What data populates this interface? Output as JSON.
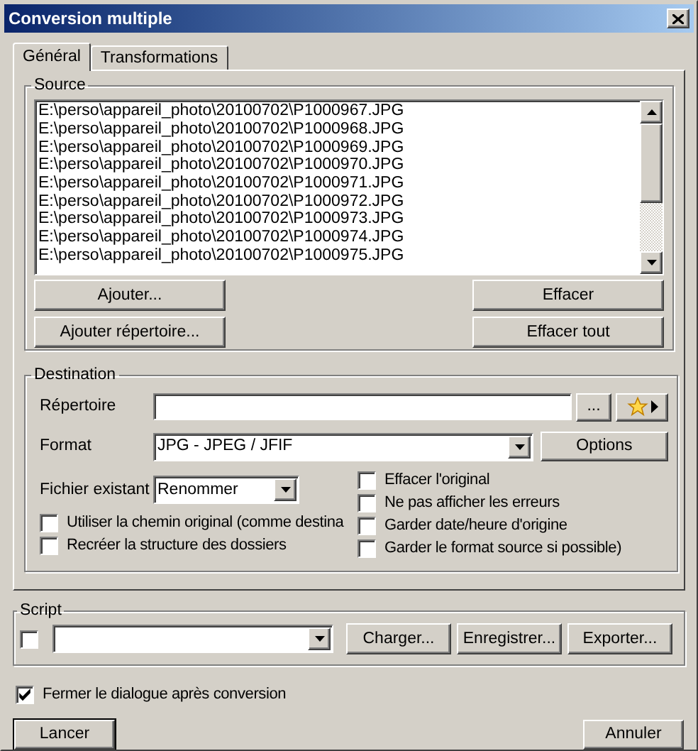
{
  "window": {
    "title": "Conversion multiple"
  },
  "tabs": [
    {
      "label": "Général",
      "selected": true
    },
    {
      "label": "Transformations",
      "selected": false
    }
  ],
  "source": {
    "label": "Source",
    "files": [
      "E:\\perso\\appareil_photo\\20100702\\P1000967.JPG",
      "E:\\perso\\appareil_photo\\20100702\\P1000968.JPG",
      "E:\\perso\\appareil_photo\\20100702\\P1000969.JPG",
      "E:\\perso\\appareil_photo\\20100702\\P1000970.JPG",
      "E:\\perso\\appareil_photo\\20100702\\P1000971.JPG",
      "E:\\perso\\appareil_photo\\20100702\\P1000972.JPG",
      "E:\\perso\\appareil_photo\\20100702\\P1000973.JPG",
      "E:\\perso\\appareil_photo\\20100702\\P1000974.JPG",
      "E:\\perso\\appareil_photo\\20100702\\P1000975.JPG"
    ],
    "left_buttons": [
      "Ajouter...",
      "Ajouter répertoire..."
    ],
    "right_buttons": [
      "Effacer",
      "Effacer tout"
    ]
  },
  "destination": {
    "label": "Destination",
    "directory": {
      "label": "Répertoire",
      "browse_button": "..."
    },
    "format": {
      "label": "Format",
      "value": "JPG - JPEG / JFIF",
      "options_button": "Options"
    },
    "existing_file": {
      "label": "Fichier existant",
      "value": "Renommer"
    },
    "left_checkboxes": [
      {
        "label": "Utiliser la chemin original (comme destina",
        "checked": false
      },
      {
        "label": "Recréer la structure des dossiers",
        "checked": false
      }
    ],
    "right_checkboxes": [
      {
        "label": "Effacer l'original",
        "checked": false
      },
      {
        "label": "Ne pas afficher les erreurs",
        "checked": false
      },
      {
        "label": "Garder date/heure d'origine",
        "checked": false
      },
      {
        "label": "Garder le format source si possible)",
        "checked": false
      }
    ]
  },
  "script": {
    "label": "Script",
    "enabled": false,
    "buttons": [
      "Charger...",
      "Enregistrer...",
      "Exporter..."
    ]
  },
  "close_after": {
    "label": "Fermer le dialogue après conversion",
    "checked": true
  },
  "footer_buttons": [
    {
      "label": "Lancer",
      "default": true
    },
    {
      "label": "Annuler",
      "default": false
    }
  ]
}
